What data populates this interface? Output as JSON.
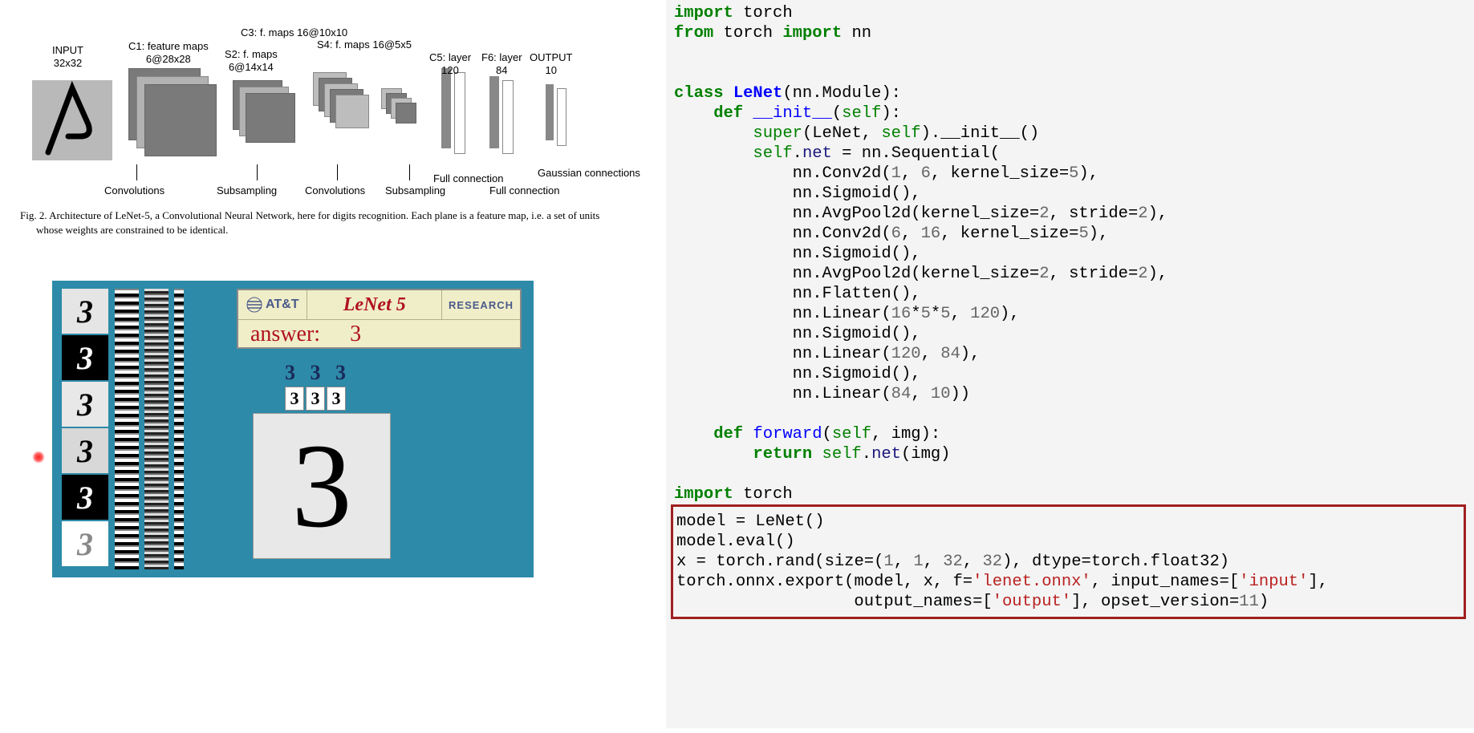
{
  "arch": {
    "labels": {
      "input": "INPUT\n32x32",
      "c1": "C1: feature maps\n6@28x28",
      "c3": "C3: f. maps 16@10x10",
      "s2": "S2: f. maps\n6@14x14",
      "s4": "S4: f. maps 16@5x5",
      "c5": "C5: layer\n120",
      "f6": "F6: layer\n84",
      "output": "OUTPUT\n10"
    },
    "bottom": {
      "conv1": "Convolutions",
      "sub1": "Subsampling",
      "conv2": "Convolutions",
      "sub2": "Subsampling",
      "fc1": "Full connection",
      "fc2": "Full connection",
      "gauss": "Gaussian connections"
    }
  },
  "caption": {
    "line1": "Fig. 2.  Architecture of LeNet-5, a Convolutional Neural Network, here for digits recognition.  Each plane is a feature map, i.e. a set of units",
    "line2": "whose weights are constrained to be identical."
  },
  "demo": {
    "att": "AT&T",
    "title": "LeNet 5",
    "research": "RESEARCH",
    "answer_label": "answer:",
    "answer_value": "3",
    "top_digits": [
      "3",
      "3",
      "3"
    ],
    "box_digits": [
      "3",
      "3",
      "3"
    ],
    "big_digit": "3",
    "thumbs": [
      {
        "bg": "#e5e5e5",
        "fg": "#000",
        "glyph": "3"
      },
      {
        "bg": "#000000",
        "fg": "#fff",
        "glyph": "3"
      },
      {
        "bg": "#e8e8e8",
        "fg": "#000",
        "glyph": "3"
      },
      {
        "bg": "#d8d8d8",
        "fg": "#000",
        "glyph": "3"
      },
      {
        "bg": "#000000",
        "fg": "#fff",
        "glyph": "3"
      },
      {
        "bg": "#ffffff",
        "fg": "#888",
        "glyph": "3"
      }
    ]
  },
  "code": {
    "l01a": "import",
    "l01b": " torch",
    "l02a": "from",
    "l02b": " torch ",
    "l02c": "import",
    "l02d": " nn",
    "l05a": "class ",
    "l05b": "LeNet",
    "l05c": "(nn",
    "l05d": ".",
    "l05e": "Module",
    "l05f": "):",
    "l06a": "    def ",
    "l06b": "__init__",
    "l06c": "(",
    "l06d": "self",
    "l06e": "):",
    "l07a": "        super",
    "l07b": "(LeNet, ",
    "l07c": "self",
    "l07d": ")",
    "l07e": ".",
    "l07f": "__init__",
    "l07g": "()",
    "l08a": "        self",
    "l08b": ".",
    "l08c": "net ",
    "l08d": "= ",
    "l08e": "nn",
    "l08f": ".",
    "l08g": "Sequential",
    "l08h": "(",
    "l09a": "            nn",
    "l09b": ".",
    "l09c": "Conv2d",
    "l09d": "(",
    "l09e": "1",
    "l09f": ", ",
    "l09g": "6",
    "l09h": ", kernel_size",
    "l09i": "=",
    "l09j": "5",
    "l09k": "),",
    "l10a": "            nn",
    "l10b": ".",
    "l10c": "Sigmoid",
    "l10d": "(),",
    "l11a": "            nn",
    "l11b": ".",
    "l11c": "AvgPool2d",
    "l11d": "(kernel_size",
    "l11e": "=",
    "l11f": "2",
    "l11g": ", stride",
    "l11h": "=",
    "l11i": "2",
    "l11j": "),",
    "l12a": "            nn",
    "l12b": ".",
    "l12c": "Conv2d",
    "l12d": "(",
    "l12e": "6",
    "l12f": ", ",
    "l12g": "16",
    "l12h": ", kernel_size",
    "l12i": "=",
    "l12j": "5",
    "l12k": "),",
    "l13a": "            nn",
    "l13b": ".",
    "l13c": "Sigmoid",
    "l13d": "(),",
    "l14a": "            nn",
    "l14b": ".",
    "l14c": "AvgPool2d",
    "l14d": "(kernel_size",
    "l14e": "=",
    "l14f": "2",
    "l14g": ", stride",
    "l14h": "=",
    "l14i": "2",
    "l14j": "),",
    "l15a": "            nn",
    "l15b": ".",
    "l15c": "Flatten",
    "l15d": "(),",
    "l16a": "            nn",
    "l16b": ".",
    "l16c": "Linear",
    "l16d": "(",
    "l16e": "16",
    "l16f": "*",
    "l16g": "5",
    "l16h": "*",
    "l16i": "5",
    "l16j": ", ",
    "l16k": "120",
    "l16l": "),",
    "l17a": "            nn",
    "l17b": ".",
    "l17c": "Sigmoid",
    "l17d": "(),",
    "l18a": "            nn",
    "l18b": ".",
    "l18c": "Linear",
    "l18d": "(",
    "l18e": "120",
    "l18f": ", ",
    "l18g": "84",
    "l18h": "),",
    "l19a": "            nn",
    "l19b": ".",
    "l19c": "Sigmoid",
    "l19d": "(),",
    "l20a": "            nn",
    "l20b": ".",
    "l20c": "Linear",
    "l20d": "(",
    "l20e": "84",
    "l20f": ", ",
    "l20g": "10",
    "l20h": "))",
    "l22a": "    def ",
    "l22b": "forward",
    "l22c": "(",
    "l22d": "self",
    "l22e": ", img):",
    "l23a": "        return ",
    "l23b": "self",
    "l23c": ".",
    "l23d": "net",
    "l23e": "(img)",
    "l25a": "import",
    "l25b": " torch",
    "l27a": "model ",
    "l27b": "= ",
    "l27c": "LeNet()",
    "l28a": "model",
    "l28b": ".",
    "l28c": "eval",
    "l28d": "()",
    "l29a": "x ",
    "l29b": "= ",
    "l29c": "torch",
    "l29d": ".",
    "l29e": "rand",
    "l29f": "(size",
    "l29g": "=",
    "l29h": "(",
    "l29i": "1",
    "l29j": ", ",
    "l29k": "1",
    "l29l": ", ",
    "l29m": "32",
    "l29n": ", ",
    "l29o": "32",
    "l29p": "), dtype",
    "l29q": "=",
    "l29r": "torch",
    "l29s": ".",
    "l29t": "float32",
    "l29u": ")",
    "l30a": "torch",
    "l30b": ".",
    "l30c": "onnx",
    "l30d": ".",
    "l30e": "export",
    "l30f": "(model, x, f",
    "l30g": "=",
    "l30h": "'lenet.onnx'",
    "l30i": ", input_names",
    "l30j": "=",
    "l30k": "[",
    "l30l": "'input'",
    "l30m": "],",
    "l31a": "                  output_names",
    "l31b": "=",
    "l31c": "[",
    "l31d": "'output'",
    "l31e": "], opset_version",
    "l31f": "=",
    "l31g": "11",
    "l31h": ")"
  }
}
